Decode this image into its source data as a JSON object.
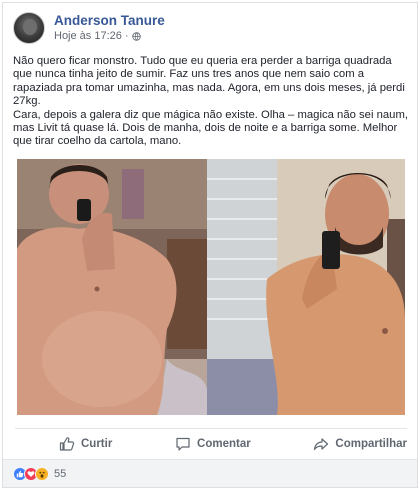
{
  "post": {
    "author": "Anderson Tanure",
    "time": "Hoje às 17:26",
    "separator": "·",
    "paragraphs": [
      "Não quero ficar monstro. Tudo que eu queria era perder a barriga quadrada que nunca tinha jeito de sumir. Faz uns tres anos que nem saio com a rapaziada pra tomar umazinha, mas nada. Agora, em uns dois meses, já perdi 27kg.",
      "Cara, depois a galera diz que mágica não existe. Olha – magica não sei naum, mas Livit tá quase lá. Dois de manha, dois de noite e a barriga some. Melhor que tirar coelho da cartola, mano."
    ]
  },
  "actions": {
    "like_label": "Curtir",
    "comment_label": "Comentar",
    "share_label": "Compartilhar"
  },
  "reactions": {
    "icons": [
      "like-icon",
      "love-icon",
      "wow-icon"
    ],
    "count": "55"
  },
  "colors": {
    "author": "#385898",
    "action_text": "#606770",
    "like_react": "#4080ff",
    "love_react": "#f33e58",
    "wow_react": "#f7b125"
  }
}
